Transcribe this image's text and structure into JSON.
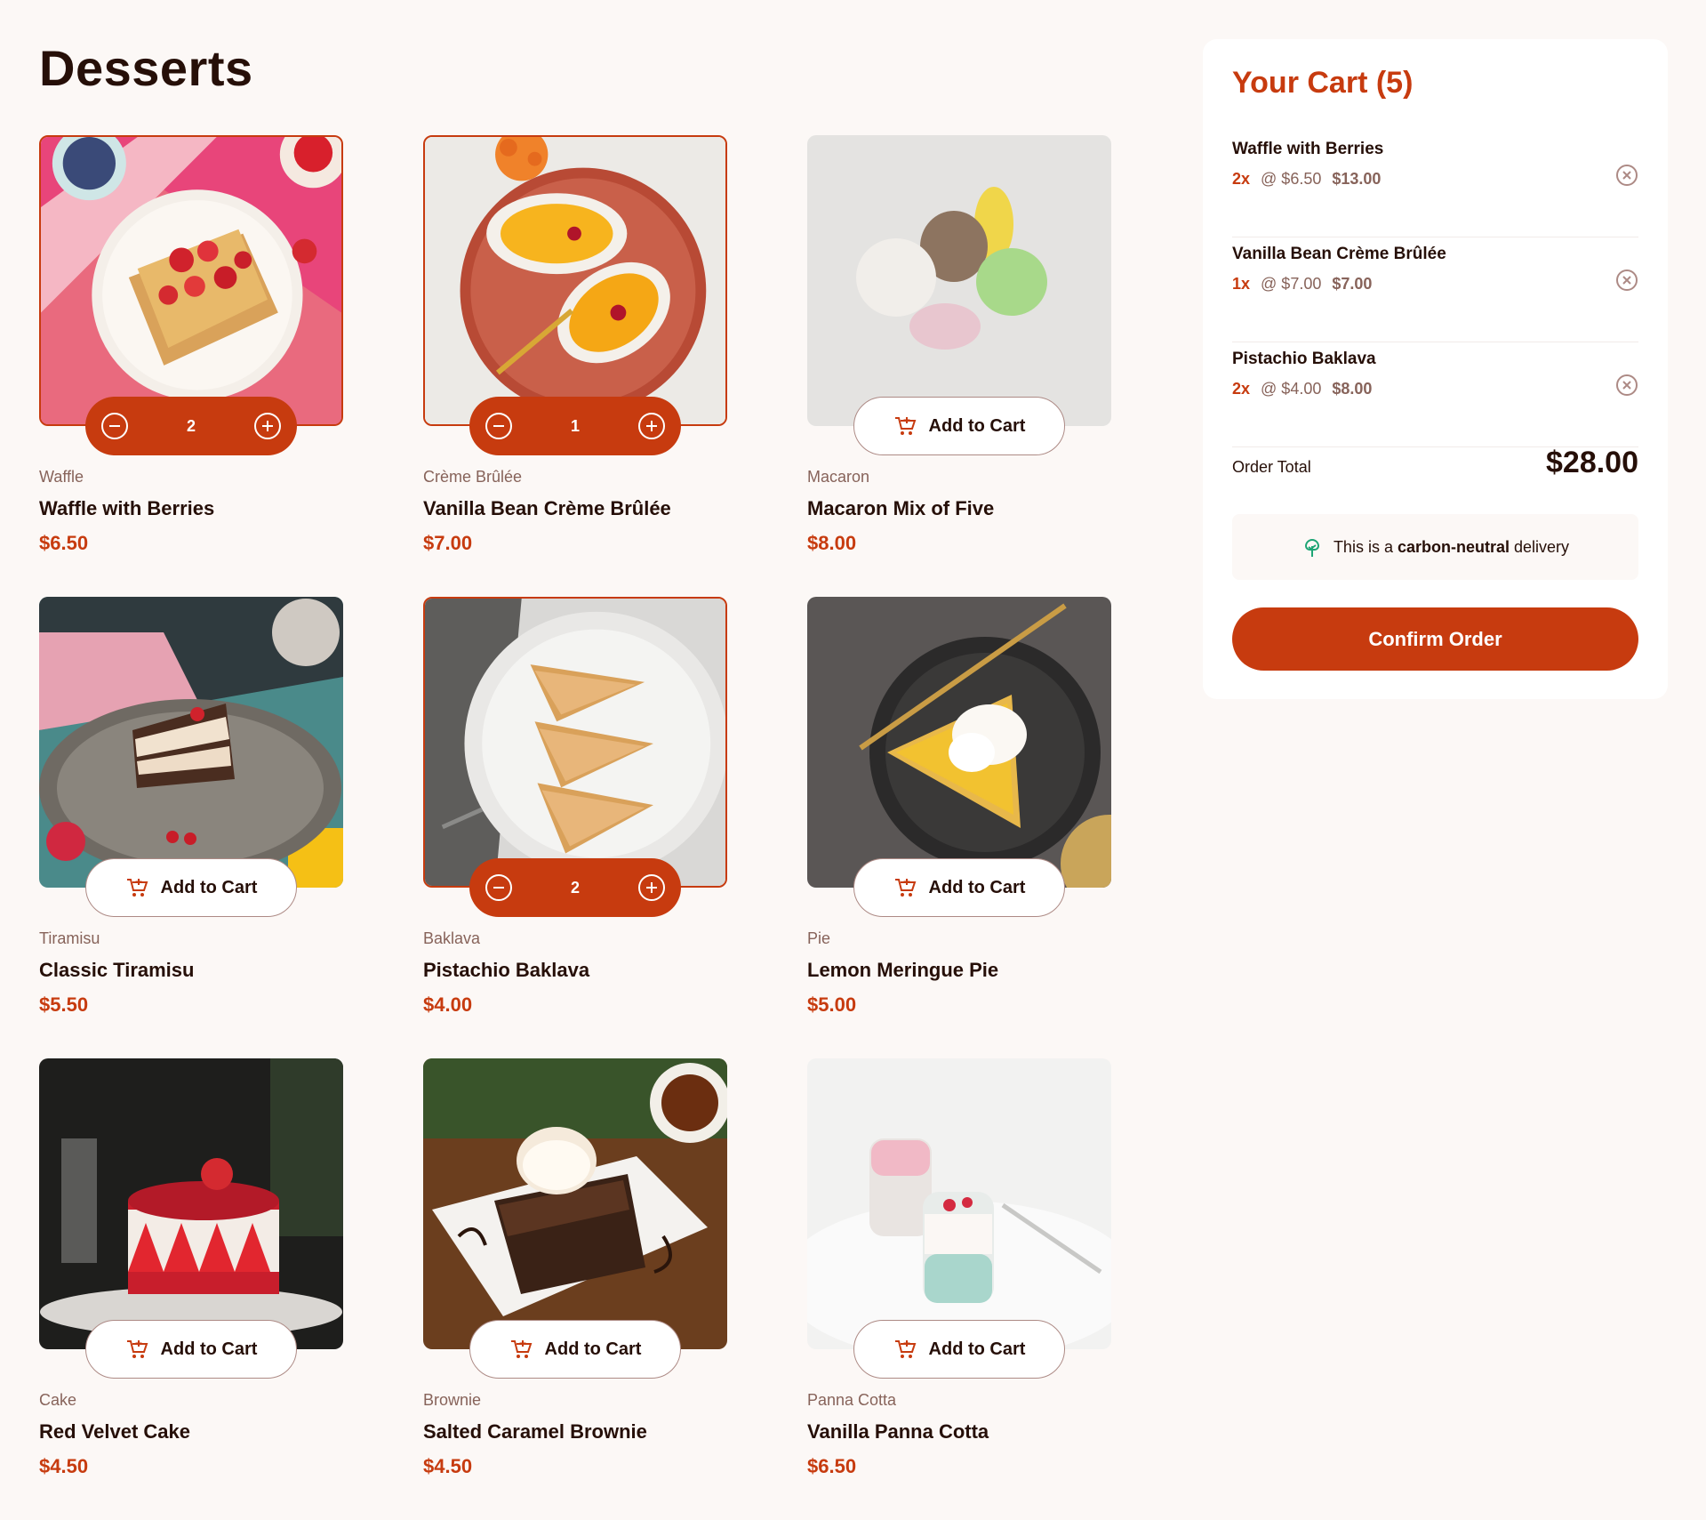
{
  "page": {
    "title": "Desserts"
  },
  "labels": {
    "add_to_cart": "Add to Cart"
  },
  "colors": {
    "accent": "#c73b0f",
    "text": "#260f08",
    "muted": "#87635a",
    "background": "#fcf8f6"
  },
  "products": [
    {
      "category": "Waffle",
      "name": "Waffle with Berries",
      "price": "$6.50",
      "in_cart": true,
      "quantity": "2",
      "image": "waffle-photo"
    },
    {
      "category": "Crème Brûlée",
      "name": "Vanilla Bean Crème Brûlée",
      "price": "$7.00",
      "in_cart": true,
      "quantity": "1",
      "image": "creme-brulee-photo"
    },
    {
      "category": "Macaron",
      "name": "Macaron Mix of Five",
      "price": "$8.00",
      "in_cart": false,
      "image": "macaron-photo"
    },
    {
      "category": "Tiramisu",
      "name": "Classic Tiramisu",
      "price": "$5.50",
      "in_cart": false,
      "image": "tiramisu-photo"
    },
    {
      "category": "Baklava",
      "name": "Pistachio Baklava",
      "price": "$4.00",
      "in_cart": true,
      "quantity": "2",
      "image": "baklava-photo"
    },
    {
      "category": "Pie",
      "name": "Lemon Meringue Pie",
      "price": "$5.00",
      "in_cart": false,
      "image": "pie-photo"
    },
    {
      "category": "Cake",
      "name": "Red Velvet Cake",
      "price": "$4.50",
      "in_cart": false,
      "image": "cake-photo"
    },
    {
      "category": "Brownie",
      "name": "Salted Caramel Brownie",
      "price": "$4.50",
      "in_cart": false,
      "image": "brownie-photo"
    },
    {
      "category": "Panna Cotta",
      "name": "Vanilla Panna Cotta",
      "price": "$6.50",
      "in_cart": false,
      "image": "panna-cotta-photo"
    }
  ],
  "cart": {
    "title": "Your Cart (5)",
    "items": [
      {
        "name": "Waffle with Berries",
        "qty": "2x",
        "unit": "@ $6.50",
        "total": "$13.00"
      },
      {
        "name": "Vanilla Bean Crème Brûlée",
        "qty": "1x",
        "unit": "@ $7.00",
        "total": "$7.00"
      },
      {
        "name": "Pistachio Baklava",
        "qty": "2x",
        "unit": "@ $4.00",
        "total": "$8.00"
      }
    ],
    "order_total_label": "Order Total",
    "order_total": "$28.00",
    "carbon_prefix": "This is a",
    "carbon_bold": "carbon-neutral",
    "carbon_suffix": "delivery",
    "confirm_label": "Confirm Order"
  }
}
